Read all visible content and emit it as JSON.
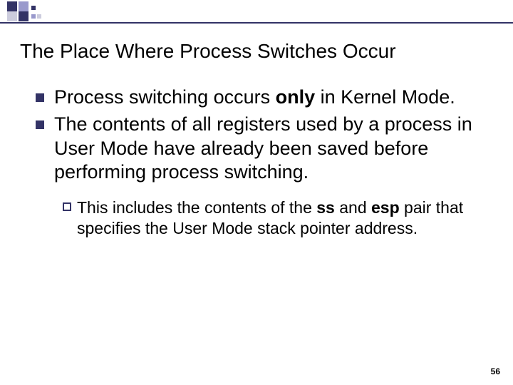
{
  "colors": {
    "accent": "#333366",
    "light1": "#9999cc",
    "light2": "#ccccdd"
  },
  "slide": {
    "title": "The Place Where Process Switches Occur",
    "bullets": [
      {
        "pre": "Process switching occurs ",
        "bold1": "only",
        "mid": " in Kernel Mode."
      },
      {
        "pre": "The contents of all registers used by a process in User Mode have already been saved before performing process switching."
      }
    ],
    "sub": {
      "pre": "This includes the contents of the ",
      "bold1": "ss",
      "mid": " and ",
      "bold2": "esp",
      "post": " pair that specifies the User Mode stack pointer address."
    },
    "page_number": "56"
  }
}
